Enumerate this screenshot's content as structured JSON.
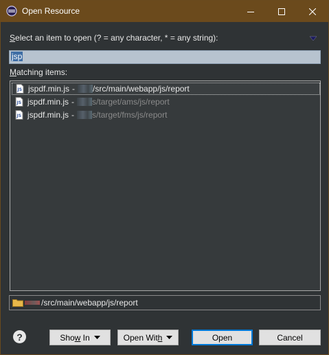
{
  "window": {
    "title": "Open Resource",
    "minimize_label": "Minimize",
    "maximize_label": "Maximize",
    "close_label": "Close"
  },
  "prompt": {
    "mnemonic": "S",
    "rest": "elect an item to open (? = any character, * = any string):"
  },
  "search": {
    "value": "jsp"
  },
  "matching": {
    "mnemonic": "M",
    "rest": "atching items:"
  },
  "items": [
    {
      "file": "jspdf.min.js",
      "separator": "-",
      "path": "/src/main/webapp/js/report",
      "dim": false,
      "selected": true
    },
    {
      "file": "jspdf.min.js",
      "separator": "-",
      "path": "s/target/ams/js/report",
      "dim": true,
      "selected": false
    },
    {
      "file": "jspdf.min.js",
      "separator": "-",
      "path": "s/target/fms/js/report",
      "dim": true,
      "selected": false
    }
  ],
  "status": {
    "path": "/src/main/webapp/js/report"
  },
  "buttons": {
    "help": "?",
    "show_in_mnemonic_pre": "Sho",
    "show_in_mnemonic": "w",
    "show_in_post": " In",
    "open_with_pre": "Open Wit",
    "open_with_mnemonic": "h",
    "open": "Open",
    "cancel": "Cancel"
  },
  "colors": {
    "titlebar": "#6b4a1c",
    "background": "#2f3335",
    "accent": "#0078d7",
    "selection": "#3f6ea5"
  }
}
